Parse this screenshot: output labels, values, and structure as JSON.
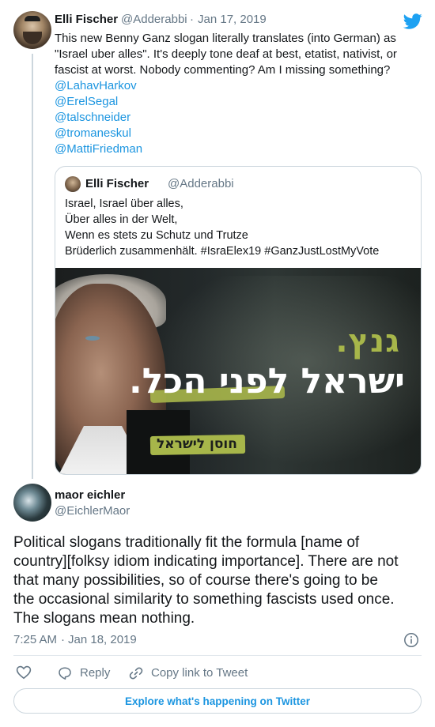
{
  "colors": {
    "brand_blue": "#1da1f2",
    "link_blue": "#1b95e0",
    "secondary_text": "#657786",
    "border": "#ccd6dd",
    "slogan_green": "#a7b64a"
  },
  "main_tweet": {
    "author_name": "Elli Fischer",
    "author_handle": "@Adderabbi",
    "separator": "·",
    "date": "Jan 17, 2019",
    "text_lines": [
      "This new Benny Ganz slogan literally translates (into German) as",
      "\"Israel uber alles\". It's deeply tone deaf at best, etatist, nativist, or",
      "fascist at worst. Nobody commenting? Am I missing something?"
    ],
    "mentions": [
      "@LahavHarkov",
      "@ErelSegal",
      "@talschneider",
      "@tromaneskul",
      "@MattiFriedman"
    ],
    "brand_icon": "twitter-bird-icon"
  },
  "quoted_tweet": {
    "author_name": "Elli Fischer",
    "author_handle": "@Adderabbi",
    "lines": [
      "Israel, Israel über alles,",
      "Über alles in der Welt,",
      "Wenn es stets zu Schutz und Trutze",
      "Brüderlich zusammenhält. #IsraElex19 #GanzJustLostMyVote"
    ],
    "image_text": {
      "title": "גנץ.",
      "slogan": "ישראל לפני הכל.",
      "subtitle": "חוסן לישראל"
    }
  },
  "reply_tweet": {
    "author_name": "maor eichler",
    "author_handle": "@EichlerMaor",
    "text_lines": [
      "Political slogans traditionally fit the formula [name of",
      "country][folksy idiom indicating importance]. There are not",
      "that many possibilities, so of course there's going to be",
      "the occasional similarity to something fascists used once.",
      "The slogans mean nothing."
    ],
    "time": "7:25 AM",
    "separator": "·",
    "date": "Jan 18, 2019",
    "info_icon": "info-icon"
  },
  "actions": {
    "like_icon": "heart-icon",
    "reply_label": "Reply",
    "copy_link_label": "Copy link to Tweet"
  },
  "footer": {
    "explore_label": "Explore what's happening on Twitter"
  }
}
